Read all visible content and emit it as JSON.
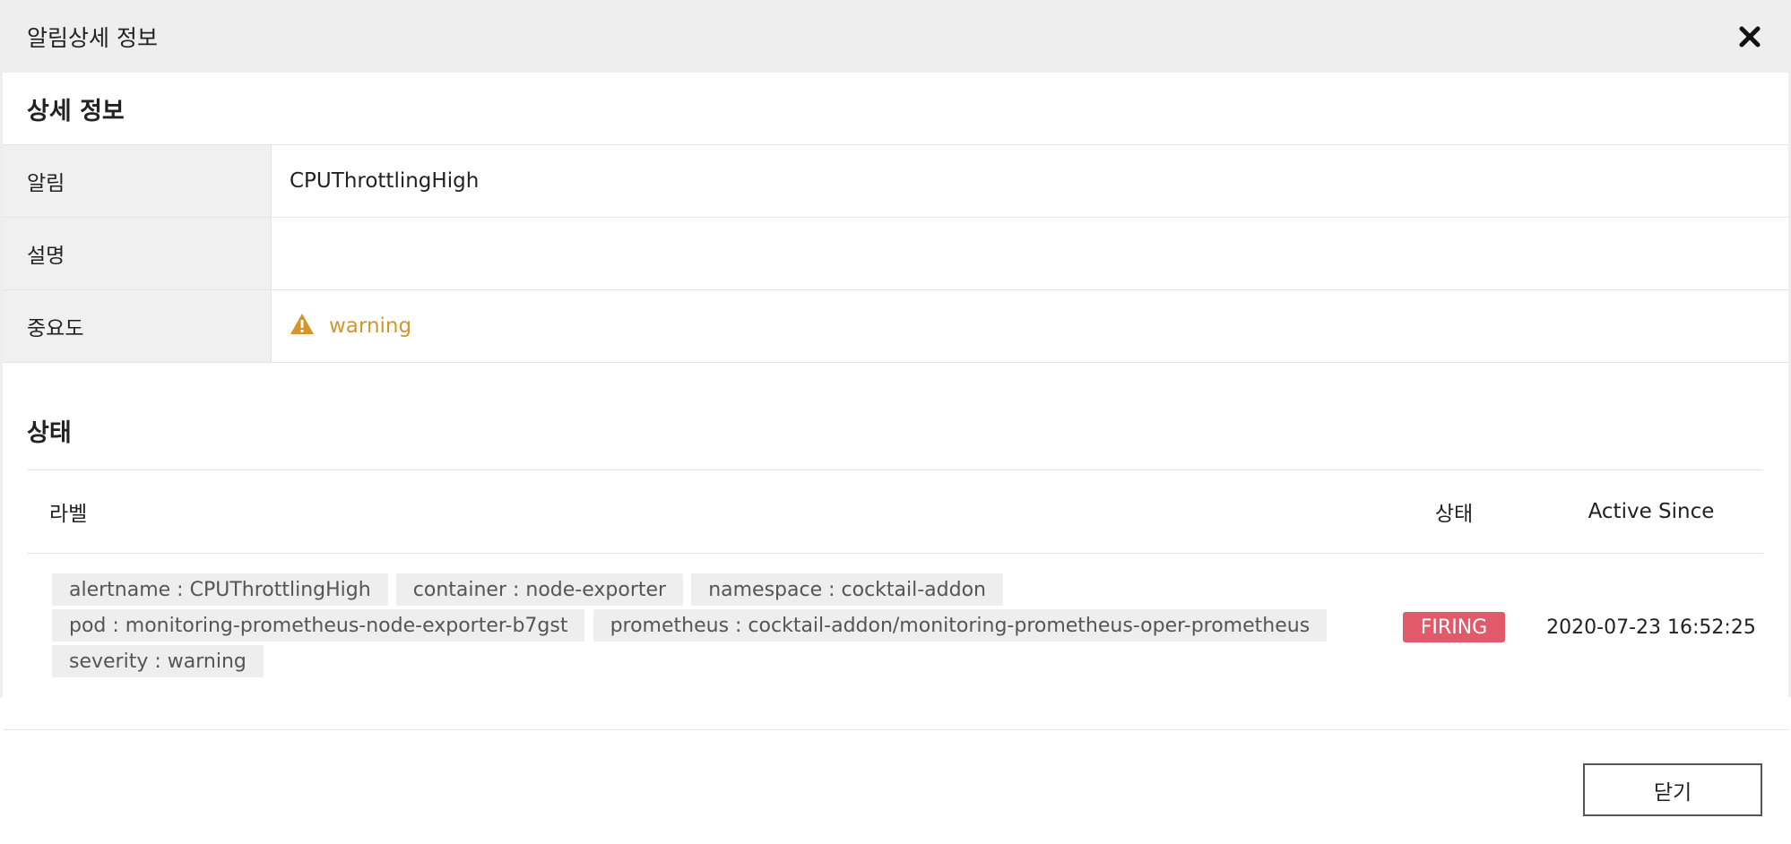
{
  "modal": {
    "title": "알림상세 정보",
    "close_icon": "close-icon"
  },
  "detail": {
    "section_title": "상세 정보",
    "rows": [
      {
        "key": "알림",
        "value": "CPUThrottlingHigh"
      },
      {
        "key": "설명",
        "value": ""
      },
      {
        "key": "중요도",
        "value": "warning",
        "icon": "warning-triangle-icon",
        "color": "#d4962b"
      }
    ]
  },
  "status": {
    "section_title": "상태",
    "columns": {
      "labels": "라벨",
      "state": "상태",
      "since": "Active Since"
    },
    "row": {
      "labels": [
        "alertname : CPUThrottlingHigh",
        "container : node-exporter",
        "namespace : cocktail-addon",
        "pod : monitoring-prometheus-node-exporter-b7gst",
        "prometheus : cocktail-addon/monitoring-prometheus-oper-prometheus",
        "severity : warning"
      ],
      "state": "FIRING",
      "state_color": "#e05a6b",
      "active_since": "2020-07-23 16:52:25"
    }
  },
  "footer": {
    "close_label": "닫기"
  }
}
